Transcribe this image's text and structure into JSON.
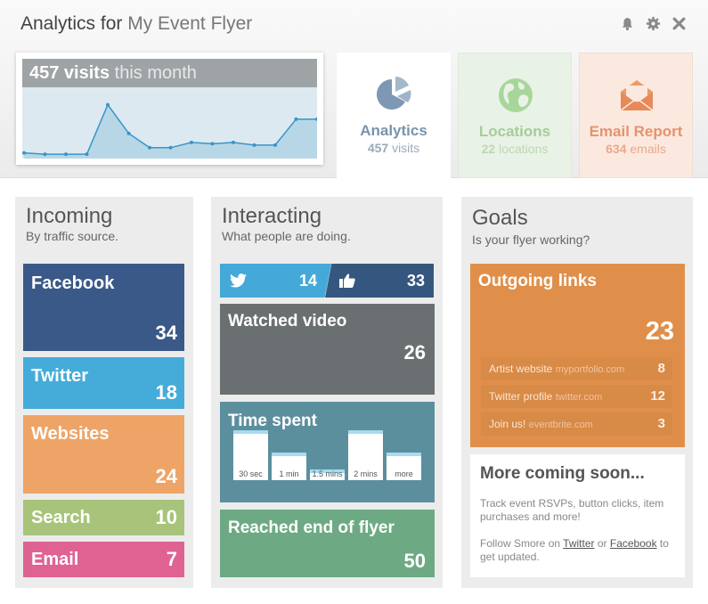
{
  "header": {
    "title_prefix": "Analytics for",
    "title_name": "My Event Flyer",
    "icons": [
      "bell-icon",
      "gear-icon",
      "close-icon"
    ]
  },
  "visits_card": {
    "count_label": "457 visits",
    "period": "this month"
  },
  "chart_data": {
    "type": "area",
    "title": "457 visits this month",
    "values": [
      3,
      2,
      2,
      2,
      40,
      18,
      7,
      7,
      11,
      10,
      11,
      9,
      9,
      29,
      29
    ],
    "ylim": [
      0,
      50
    ],
    "color": "#3a94c9",
    "fill": "#b8d7e6",
    "grid": false
  },
  "tabs": [
    {
      "label": "Analytics",
      "sub_num": "457",
      "sub_text": "visits",
      "icon": "pie-chart-icon"
    },
    {
      "label": "Locations",
      "sub_num": "22",
      "sub_text": "locations",
      "icon": "globe-icon"
    },
    {
      "label": "Email Report",
      "sub_num": "634",
      "sub_text": "emails",
      "icon": "envelope-icon"
    }
  ],
  "incoming": {
    "title": "Incoming",
    "subtitle": "By traffic source.",
    "sources": [
      {
        "label": "Facebook",
        "value": "34",
        "color": "#3a5988"
      },
      {
        "label": "Twitter",
        "value": "18",
        "color": "#45acd9"
      },
      {
        "label": "Websites",
        "value": "24",
        "color": "#eea467"
      },
      {
        "label": "Search",
        "value": "10",
        "color": "#a7c47a"
      },
      {
        "label": "Email",
        "value": "7",
        "color": "#df6293"
      }
    ]
  },
  "interacting": {
    "title": "Interacting",
    "subtitle": "What people are doing.",
    "twitter_count": "14",
    "facebook_count": "33",
    "watched_video": {
      "label": "Watched video",
      "value": "26",
      "color": "#6a6f71"
    },
    "time_spent": {
      "label": "Time spent",
      "color": "#5c8f9e",
      "buckets": [
        {
          "label": "30 sec",
          "value": 1.0
        },
        {
          "label": "1 min",
          "value": 0.55
        },
        {
          "label": "1.5 mins",
          "value": 0.2
        },
        {
          "label": "2 mins",
          "value": 1.0
        },
        {
          "label": "more",
          "value": 0.55
        }
      ]
    },
    "reached_end": {
      "label": "Reached end of flyer",
      "value": "50",
      "color": "#6daa83"
    }
  },
  "goals": {
    "title": "Goals",
    "subtitle": "Is your flyer working?",
    "outgoing": {
      "label": "Outgoing links",
      "total": "23",
      "color": "#e08f4b",
      "links": [
        {
          "label": "Artist website",
          "domain": "myportfolio.com",
          "count": "8"
        },
        {
          "label": "Twitter profile",
          "domain": "twitter.com",
          "count": "12"
        },
        {
          "label": "Join us!",
          "domain": "eventbrite.com",
          "count": "3"
        }
      ]
    },
    "coming_soon": {
      "title": "More coming soon...",
      "text": "Track event RSVPs, button clicks, item purchases and more!",
      "follow_prefix": "Follow Smore on",
      "twitter_link": "Twitter",
      "or": "or",
      "facebook_link": "Facebook",
      "follow_suffix": "to get updated."
    }
  }
}
